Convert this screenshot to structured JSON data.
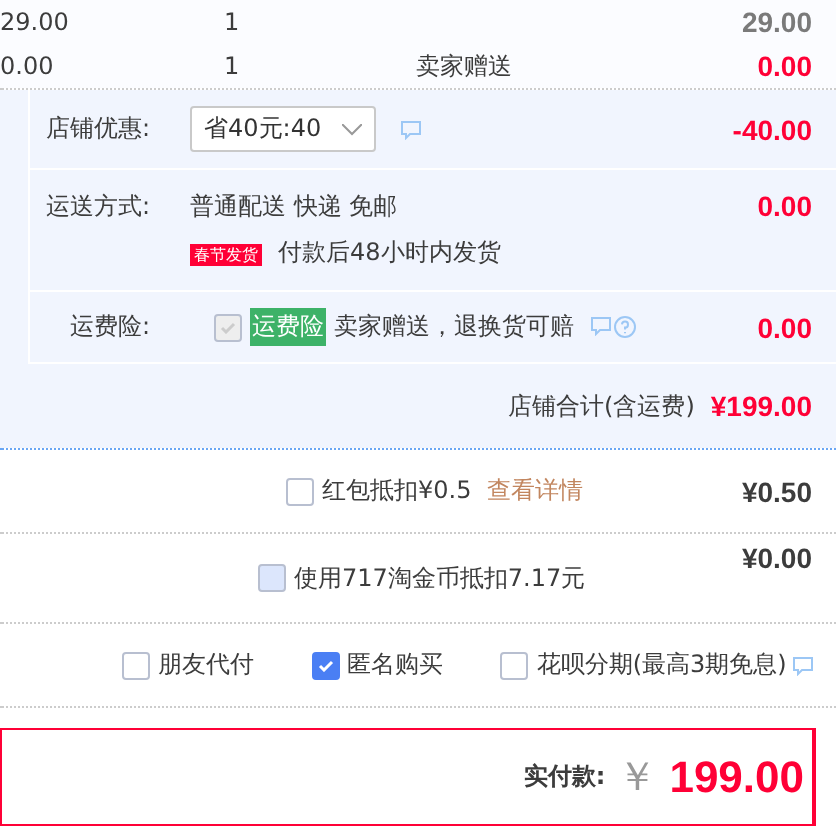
{
  "items": [
    {
      "price": "29.00",
      "quantity": "1",
      "subtotal": "29.00",
      "gift": false
    },
    {
      "price": "0.00",
      "quantity": "1",
      "note": "卖家赠送",
      "subtotal": "0.00",
      "gift": true
    }
  ],
  "shop_discount": {
    "label": "店铺优惠:",
    "select_value": "省40元:40",
    "amount": "-40.00"
  },
  "shipping": {
    "label": "运送方式:",
    "method": "普通配送 快递 免邮",
    "badge": "春节发货",
    "promise": "付款后48小时内发货",
    "amount": "0.00"
  },
  "insurance": {
    "label": "运费险:",
    "checked": true,
    "disabled": true,
    "tag": "运费险",
    "text": "卖家赠送，退换货可赔",
    "amount": "0.00"
  },
  "shop_total": {
    "label": "店铺合计(含运费)",
    "amount": "¥199.00"
  },
  "red_packet": {
    "checked": false,
    "label": "红包抵扣¥0.5",
    "link": "查看详情",
    "amount": "¥0.50"
  },
  "coins": {
    "checked": false,
    "label": "使用717淘金币抵扣7.17元",
    "amount": "¥0.00"
  },
  "options": [
    {
      "label": "朋友代付",
      "checked": false
    },
    {
      "label": "匿名购买",
      "checked": true
    },
    {
      "label": "花呗分期(最高3期免息)",
      "checked": false
    }
  ],
  "payment": {
    "label": "实付款:",
    "currency": "￥",
    "amount": "199.00"
  }
}
